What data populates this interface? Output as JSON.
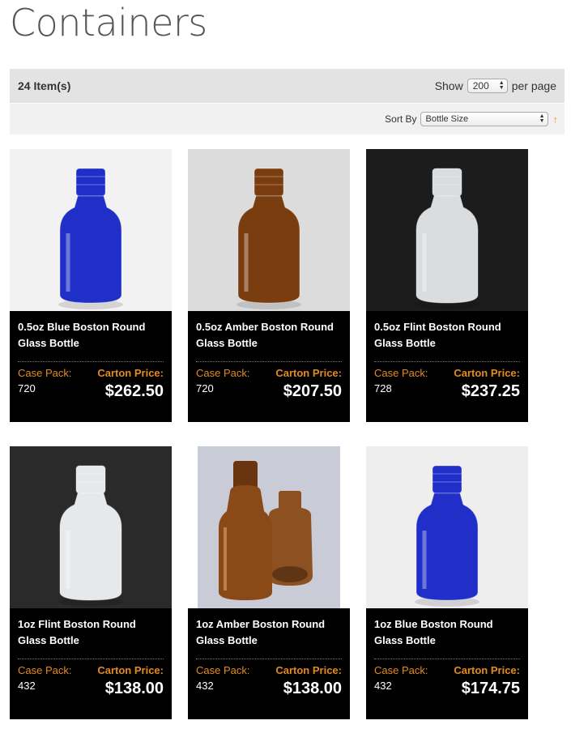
{
  "page": {
    "title": "Containers"
  },
  "toolbar": {
    "item_count": "24 Item(s)",
    "show_label": "Show",
    "per_page_value": "200",
    "per_page_suffix": "per page",
    "sort_label": "Sort By",
    "sort_value": "Bottle Size",
    "sort_direction_icon": "arrow-up-icon",
    "accent_color": "#f39a1b"
  },
  "products": [
    {
      "name": "0.5oz Blue Boston Round Glass Bottle",
      "case_pack_label": "Case Pack:",
      "case_pack": "720",
      "price_label": "Carton Price:",
      "price": "$262.50",
      "glass_color": "#1f2fc7",
      "bg_color": "#f2f2f2"
    },
    {
      "name": "0.5oz Amber Boston Round Glass Bottle",
      "case_pack_label": "Case Pack:",
      "case_pack": "720",
      "price_label": "Carton Price:",
      "price": "$207.50",
      "glass_color": "#7a3d0f",
      "bg_color": "#dcdcdc"
    },
    {
      "name": "0.5oz Flint Boston Round Glass Bottle",
      "case_pack_label": "Case Pack:",
      "case_pack": "728",
      "price_label": "Carton Price:",
      "price": "$237.25",
      "glass_color": "#d9dde0",
      "bg_color": "#1c1c1c"
    },
    {
      "name": "1oz Flint Boston Round Glass Bottle",
      "case_pack_label": "Case Pack:",
      "case_pack": "432",
      "price_label": "Carton Price:",
      "price": "$138.00",
      "glass_color": "#e6e8ea",
      "bg_color": "#2a2a2a"
    },
    {
      "name": "1oz Amber Boston Round Glass Bottle",
      "case_pack_label": "Case Pack:",
      "case_pack": "432",
      "price_label": "Carton Price:",
      "price": "$138.00",
      "glass_color": "#8a4a18",
      "bg_color": "#c9cbd6"
    },
    {
      "name": "1oz Blue Boston Round Glass Bottle",
      "case_pack_label": "Case Pack:",
      "case_pack": "432",
      "price_label": "Carton Price:",
      "price": "$174.75",
      "glass_color": "#1f2fc7",
      "bg_color": "#eeeeee"
    }
  ]
}
